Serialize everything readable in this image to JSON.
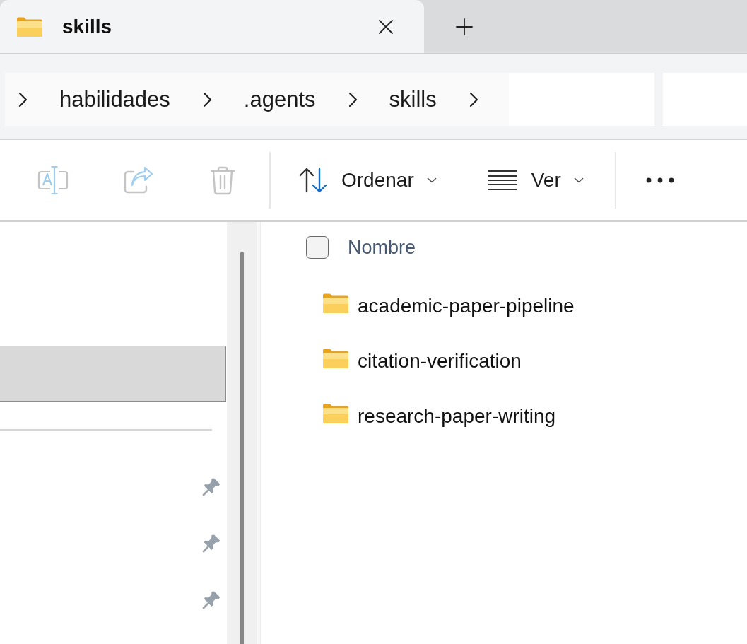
{
  "tabs": [
    {
      "title": "skills",
      "selected": true
    }
  ],
  "address_bar": {
    "breadcrumbs": [
      {
        "label": "habilidades"
      },
      {
        "label": ".agents"
      },
      {
        "label": "skills"
      }
    ]
  },
  "toolbar": {
    "actions": [
      {
        "kind": "rename",
        "disabled": true
      },
      {
        "kind": "share",
        "disabled": true
      },
      {
        "kind": "delete",
        "disabled": true
      }
    ],
    "menus": [
      {
        "kind": "sort",
        "label": "Ordenar"
      },
      {
        "kind": "view",
        "label": "Ver"
      }
    ]
  },
  "navigation_pane": {
    "top_items": [
      {
        "selected": true
      }
    ],
    "pinned_items": [
      {
        "pinned": true
      },
      {
        "pinned": true
      },
      {
        "pinned": true
      }
    ]
  },
  "file_list": {
    "select_all": {
      "checked": false
    },
    "columns": [
      {
        "label": "Nombre"
      }
    ],
    "rows": [
      {
        "name": "academic-paper-pipeline",
        "selected": false
      },
      {
        "name": "citation-verification",
        "selected": false
      },
      {
        "name": "research-paper-writing",
        "selected": false
      }
    ]
  }
}
